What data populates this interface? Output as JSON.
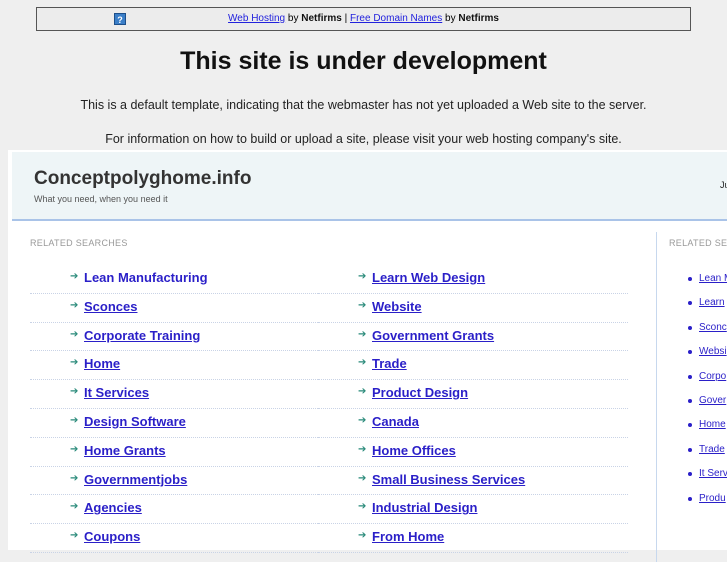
{
  "banner": {
    "link1": "Web Hosting",
    "by1": " by ",
    "brand1": "Netfirms",
    "sep": " | ",
    "link2": "Free Domain Names",
    "by2": " by ",
    "brand2": "Netfirms",
    "icon": "question-icon"
  },
  "heading": "This site is under development",
  "para1": "This is a default template, indicating that the webmaster has not yet uploaded a Web site to the server.",
  "para2": "For information on how to build or upload a site, please visit your web hosting company's site.",
  "site": {
    "name": "Conceptpolyghome.info",
    "tagline": "What you need, when you need it",
    "right_text": "Ju"
  },
  "related_label": "RELATED SEARCHES",
  "side_label": "RELATED SE",
  "col1": [
    "Lean Manufacturing",
    "Sconces",
    "Corporate Training",
    "Home",
    "It Services",
    "Design Software",
    "Home Grants",
    "Governmentjobs",
    "Agencies",
    "Coupons"
  ],
  "col2": [
    "Learn Web Design",
    "Website",
    "Government Grants",
    "Trade",
    "Product Design",
    "Canada",
    "Home Offices",
    "Small Business Services",
    "Industrial Design",
    "From Home"
  ],
  "side": [
    "Lean M",
    "Learn",
    "Sconc",
    "Websi",
    "Corpo",
    "Gover",
    "Home",
    "Trade",
    "It Serv",
    "Produ"
  ]
}
